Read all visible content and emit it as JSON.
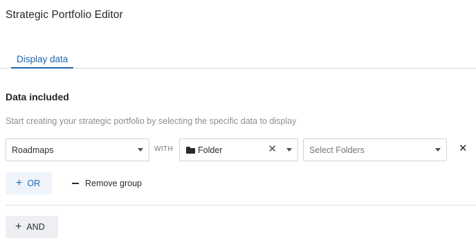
{
  "page": {
    "title": "Strategic Portfolio Editor"
  },
  "tabs": [
    {
      "label": "Display data",
      "active": true
    }
  ],
  "section": {
    "title": "Data included",
    "hint": "Start creating your strategic portfolio by selecting the specific data to display"
  },
  "filter_row": {
    "source_value": "Roadmaps",
    "connector": "WITH",
    "type_icon": "folder-icon",
    "type_value": "Folder",
    "clear_icon": "close-icon",
    "target_placeholder": "Select Folders",
    "remove_icon": "close-icon",
    "clear_glyph": "✕",
    "remove_glyph": "✕"
  },
  "actions": {
    "or_label": "OR",
    "remove_group_label": "Remove group",
    "and_label": "AND",
    "plus_glyph": "+"
  },
  "colors": {
    "accent": "#1b67b3",
    "or_button_bg": "#eef4fa",
    "and_button_bg": "#edeff2",
    "border": "#cfd4da"
  }
}
